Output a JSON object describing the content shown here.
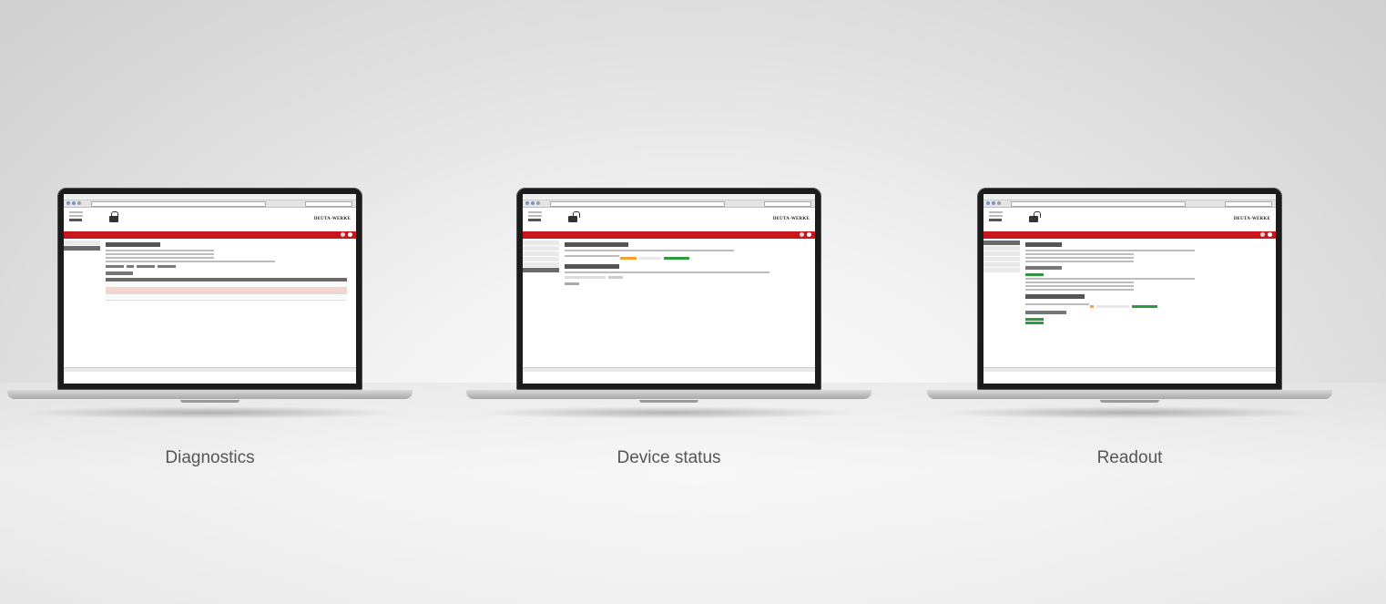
{
  "captions": [
    "Diagnostics",
    "Device status",
    "Readout"
  ],
  "brand": {
    "logo_text": "DEUTA-WERKE",
    "accent": "#c8161c"
  },
  "icons": [
    "lock-icon",
    "unlock-icon"
  ]
}
